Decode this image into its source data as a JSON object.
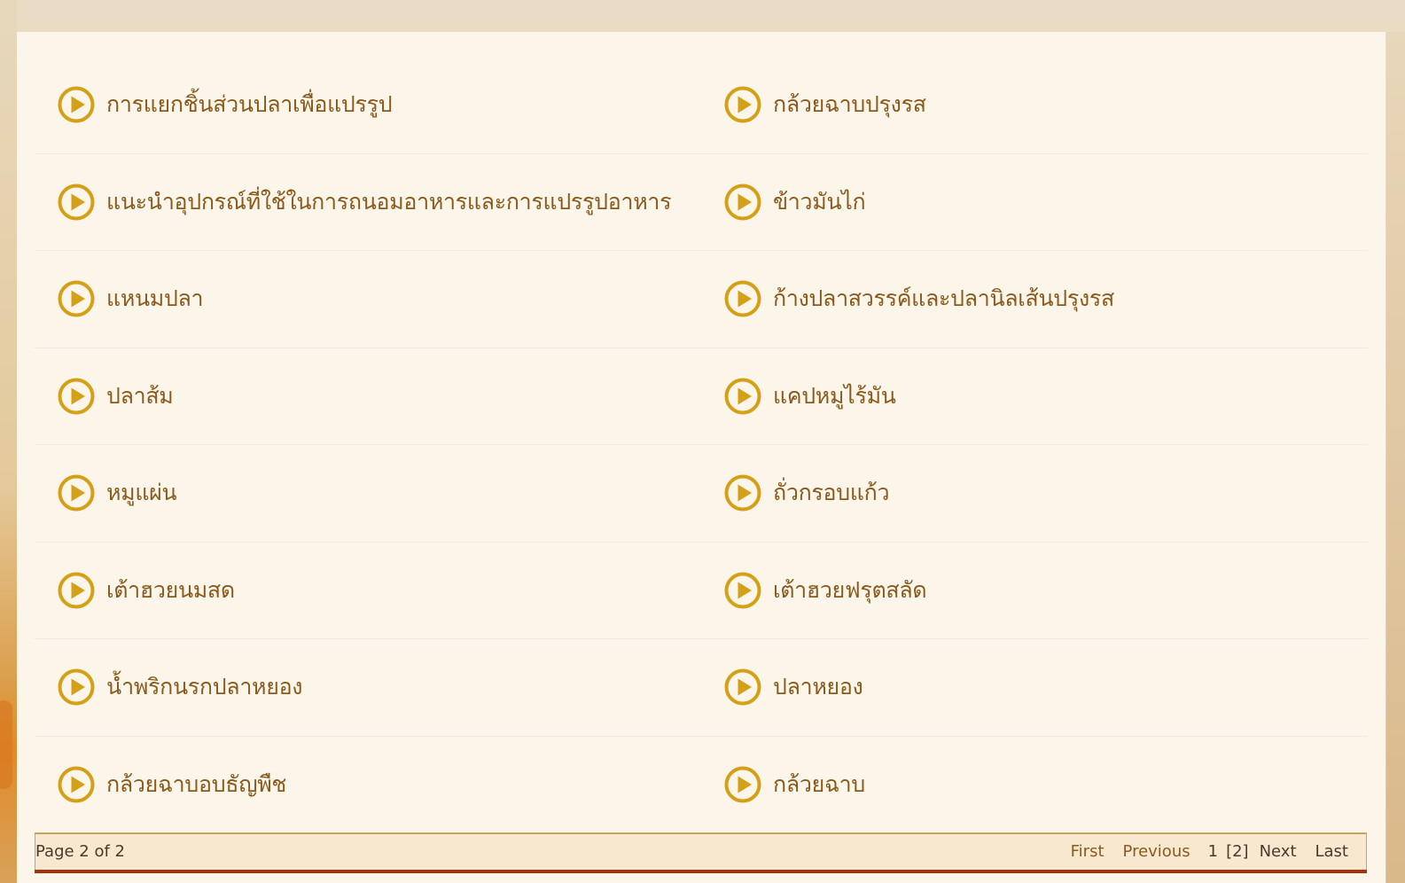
{
  "theme": {
    "accent": "#d4a017",
    "text": "#8a5a1c",
    "pager_bg": "#f8e8cf",
    "pager_border": "#c9a45a",
    "pager_underline": "#a8300c"
  },
  "items": [
    {
      "label": "การแยกชิ้นส่วนปลาเพื่อแปรรูป",
      "icon": "play-circle-icon"
    },
    {
      "label": "กล้วยฉาบปรุงรส",
      "icon": "play-circle-icon"
    },
    {
      "label": "แนะนำอุปกรณ์ที่ใช้ในการถนอมอาหารและการแปรรูปอาหาร",
      "icon": "play-circle-icon"
    },
    {
      "label": "ข้าวมันไก่",
      "icon": "play-circle-icon"
    },
    {
      "label": "แหนมปลา",
      "icon": "play-circle-icon"
    },
    {
      "label": "ก้างปลาสวรรค์และปลานิลเส้นปรุงรส",
      "icon": "play-circle-icon"
    },
    {
      "label": "ปลาส้ม",
      "icon": "play-circle-icon"
    },
    {
      "label": "แคปหมูไร้มัน",
      "icon": "play-circle-icon"
    },
    {
      "label": "หมูแผ่น",
      "icon": "play-circle-icon"
    },
    {
      "label": "ถั่วกรอบแก้ว",
      "icon": "play-circle-icon"
    },
    {
      "label": "เต้าฮวยนมสด",
      "icon": "play-circle-icon"
    },
    {
      "label": "เต้าฮวยฟรุตสลัด",
      "icon": "play-circle-icon"
    },
    {
      "label": "น้ำพริกนรกปลาหยอง",
      "icon": "play-circle-icon"
    },
    {
      "label": "ปลาหยอง",
      "icon": "play-circle-icon"
    },
    {
      "label": "กล้วยฉาบอบธัญพืช",
      "icon": "play-circle-icon"
    },
    {
      "label": "กล้วยฉาบ",
      "icon": "play-circle-icon"
    }
  ],
  "pagination": {
    "page_info": "Page 2 of 2",
    "current_page": 2,
    "total_pages": 2,
    "first": "First",
    "previous": "Previous",
    "page_1": "1",
    "page_2_current": "[2]",
    "next": "Next",
    "last": "Last"
  }
}
